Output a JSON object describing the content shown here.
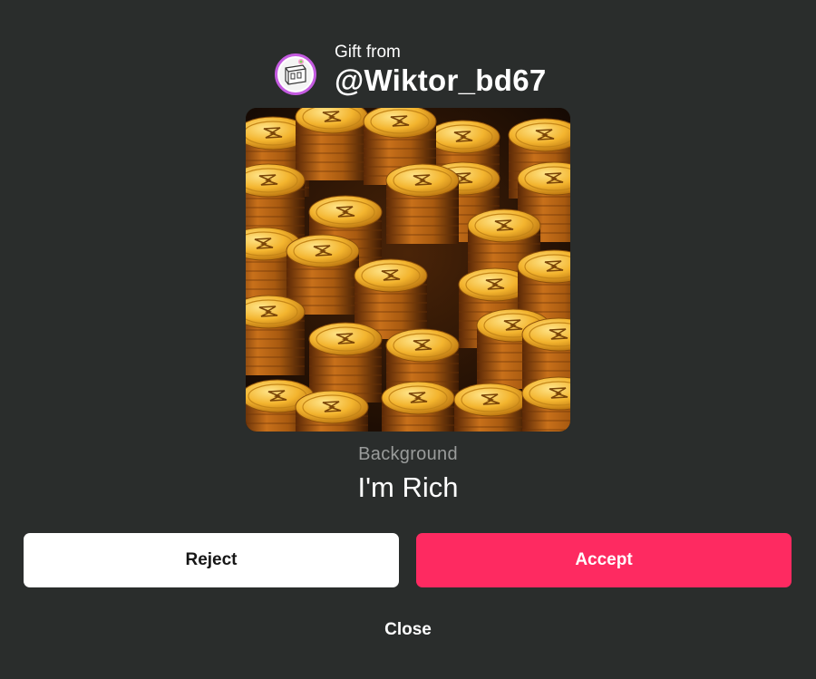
{
  "sender": {
    "label": "Gift from",
    "username": "@Wiktor_bd67",
    "avatar_icon": "avatar-icon"
  },
  "gift": {
    "image_icon": "gold-coins-image",
    "type_label": "Background",
    "name": "I'm Rich"
  },
  "actions": {
    "reject_label": "Reject",
    "accept_label": "Accept",
    "close_label": "Close"
  },
  "colors": {
    "background": "#2a2d2c",
    "accent": "#fe2a61",
    "reject_bg": "#ffffff",
    "secondary_text": "#9a9c9b"
  }
}
